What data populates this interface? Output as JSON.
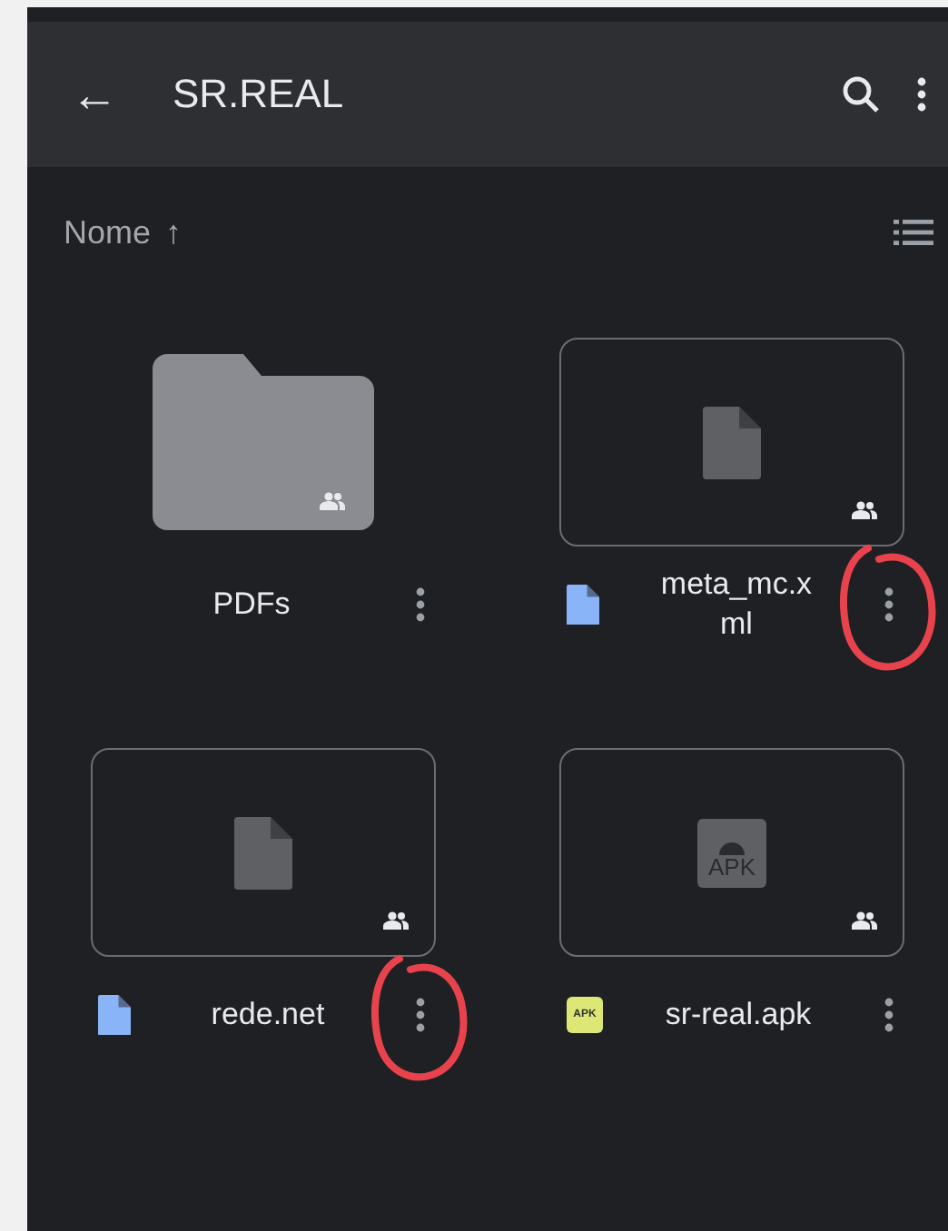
{
  "app_bar": {
    "back": "←",
    "title": "SR.REAL"
  },
  "sort": {
    "label": "Nome",
    "arrow": "↑"
  },
  "items": [
    {
      "kind": "folder",
      "name": "PDFs",
      "shared": true,
      "circled": false
    },
    {
      "kind": "file",
      "name": "meta_mc.x\nml",
      "shared": true,
      "circled": true
    },
    {
      "kind": "file",
      "name": "rede.net",
      "shared": true,
      "circled": true
    },
    {
      "kind": "apk",
      "name": "sr-real.apk",
      "badge": "APK",
      "thumb_label": "APK",
      "shared": true,
      "circled": false
    }
  ]
}
